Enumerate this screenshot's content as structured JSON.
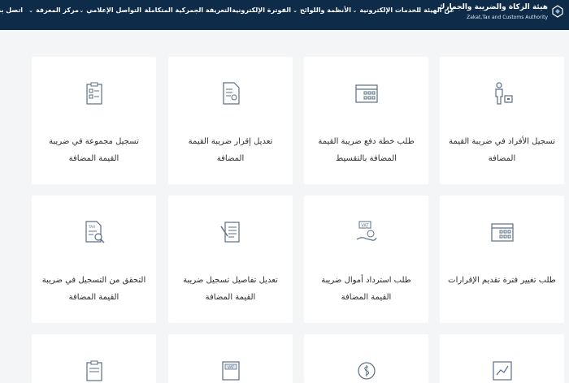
{
  "header": {
    "org_name_ar": "هيئة الزكاة والضريبة والجمارك",
    "org_name_en": "Zakat,Tax and Customs Authority",
    "nav": [
      {
        "label": "عن الهيئة",
        "chevron": true
      },
      {
        "label": "الخدمات الإلكترونية",
        "chevron": true
      },
      {
        "label": "الأنظمة واللوائح",
        "chevron": true
      },
      {
        "label": "الفوترة الإلكترونية",
        "chevron": false
      },
      {
        "label": "التعريفة الجمركية المتكاملة",
        "chevron": false
      },
      {
        "label": "التواصل الإعلامي",
        "chevron": true
      },
      {
        "label": "مركز المعرفة",
        "chevron": true
      },
      {
        "label": "اتصل بنا",
        "chevron": false
      }
    ]
  },
  "services": [
    {
      "title": "تسجيل الأفراد في ضريبة القيمة المضافة",
      "icon": "person-register-icon"
    },
    {
      "title": "طلب خطة دفع ضريبة القيمة المضافة بالتقسيط",
      "icon": "calendar-icon"
    },
    {
      "title": "تعديل إقرار ضريبة القيمة المضافة",
      "icon": "document-edit-icon"
    },
    {
      "title": "تسجيل مجموعة في ضريبة القيمة المضافة",
      "icon": "clipboard-checklist-icon"
    },
    {
      "title": "طلب تغيير فترة تقديم الإقرارات",
      "icon": "calendar-icon"
    },
    {
      "title": "طلب استرداد أموال ضريبة القيمة المضافة",
      "icon": "vat-refund-hand-icon"
    },
    {
      "title": "تعديل تفاصيل تسجيل ضريبة القيمة المضافة",
      "icon": "document-pen-icon"
    },
    {
      "title": "التحقق من التسجيل في ضريبة القيمة المضافة",
      "icon": "tax-document-search-icon"
    }
  ]
}
